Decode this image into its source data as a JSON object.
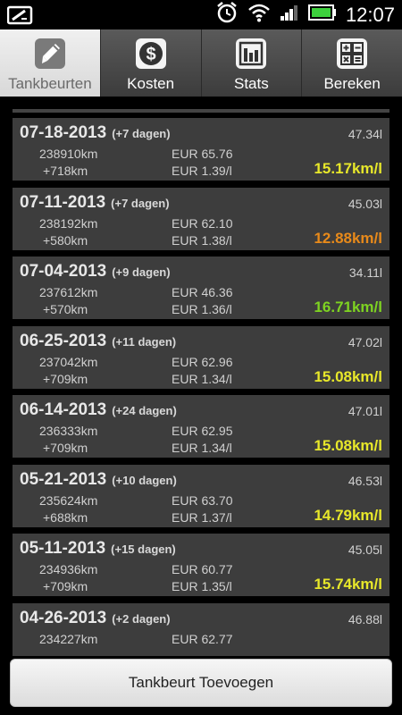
{
  "status_bar": {
    "time": "12:07"
  },
  "tabs": [
    {
      "label": "Tankbeurten",
      "icon": "fuel-pump-icon",
      "active": true
    },
    {
      "label": "Kosten",
      "icon": "dollar-icon",
      "active": false
    },
    {
      "label": "Stats",
      "icon": "bar-chart-icon",
      "active": false
    },
    {
      "label": "Bereken",
      "icon": "calculator-icon",
      "active": false
    }
  ],
  "colors": {
    "yellow": "#e8e82a",
    "orange": "#e88a1a",
    "green": "#7ed321"
  },
  "entries": [
    {
      "date": "07-18-2013",
      "days": "(+7 dagen)",
      "liters": "47.34l",
      "odo": "238910km",
      "cost": "EUR 65.76",
      "dist": "+718km",
      "price": "EUR 1.39/l",
      "eff": "15.17km/l",
      "eff_color": "yellow"
    },
    {
      "date": "07-11-2013",
      "days": "(+7 dagen)",
      "liters": "45.03l",
      "odo": "238192km",
      "cost": "EUR 62.10",
      "dist": "+580km",
      "price": "EUR 1.38/l",
      "eff": "12.88km/l",
      "eff_color": "orange"
    },
    {
      "date": "07-04-2013",
      "days": "(+9 dagen)",
      "liters": "34.11l",
      "odo": "237612km",
      "cost": "EUR 46.36",
      "dist": "+570km",
      "price": "EUR 1.36/l",
      "eff": "16.71km/l",
      "eff_color": "green"
    },
    {
      "date": "06-25-2013",
      "days": "(+11 dagen)",
      "liters": "47.02l",
      "odo": "237042km",
      "cost": "EUR 62.96",
      "dist": "+709km",
      "price": "EUR 1.34/l",
      "eff": "15.08km/l",
      "eff_color": "yellow"
    },
    {
      "date": "06-14-2013",
      "days": "(+24 dagen)",
      "liters": "47.01l",
      "odo": "236333km",
      "cost": "EUR 62.95",
      "dist": "+709km",
      "price": "EUR 1.34/l",
      "eff": "15.08km/l",
      "eff_color": "yellow"
    },
    {
      "date": "05-21-2013",
      "days": "(+10 dagen)",
      "liters": "46.53l",
      "odo": "235624km",
      "cost": "EUR 63.70",
      "dist": "+688km",
      "price": "EUR 1.37/l",
      "eff": "14.79km/l",
      "eff_color": "yellow"
    },
    {
      "date": "05-11-2013",
      "days": "(+15 dagen)",
      "liters": "45.05l",
      "odo": "234936km",
      "cost": "EUR 60.77",
      "dist": "+709km",
      "price": "EUR 1.35/l",
      "eff": "15.74km/l",
      "eff_color": "yellow"
    },
    {
      "date": "04-26-2013",
      "days": "(+2 dagen)",
      "liters": "46.88l",
      "odo": "234227km",
      "cost": "EUR 62.77",
      "dist": "",
      "price": "",
      "eff": "",
      "eff_color": "yellow"
    }
  ],
  "bottom_button": {
    "label": "Tankbeurt Toevoegen"
  }
}
